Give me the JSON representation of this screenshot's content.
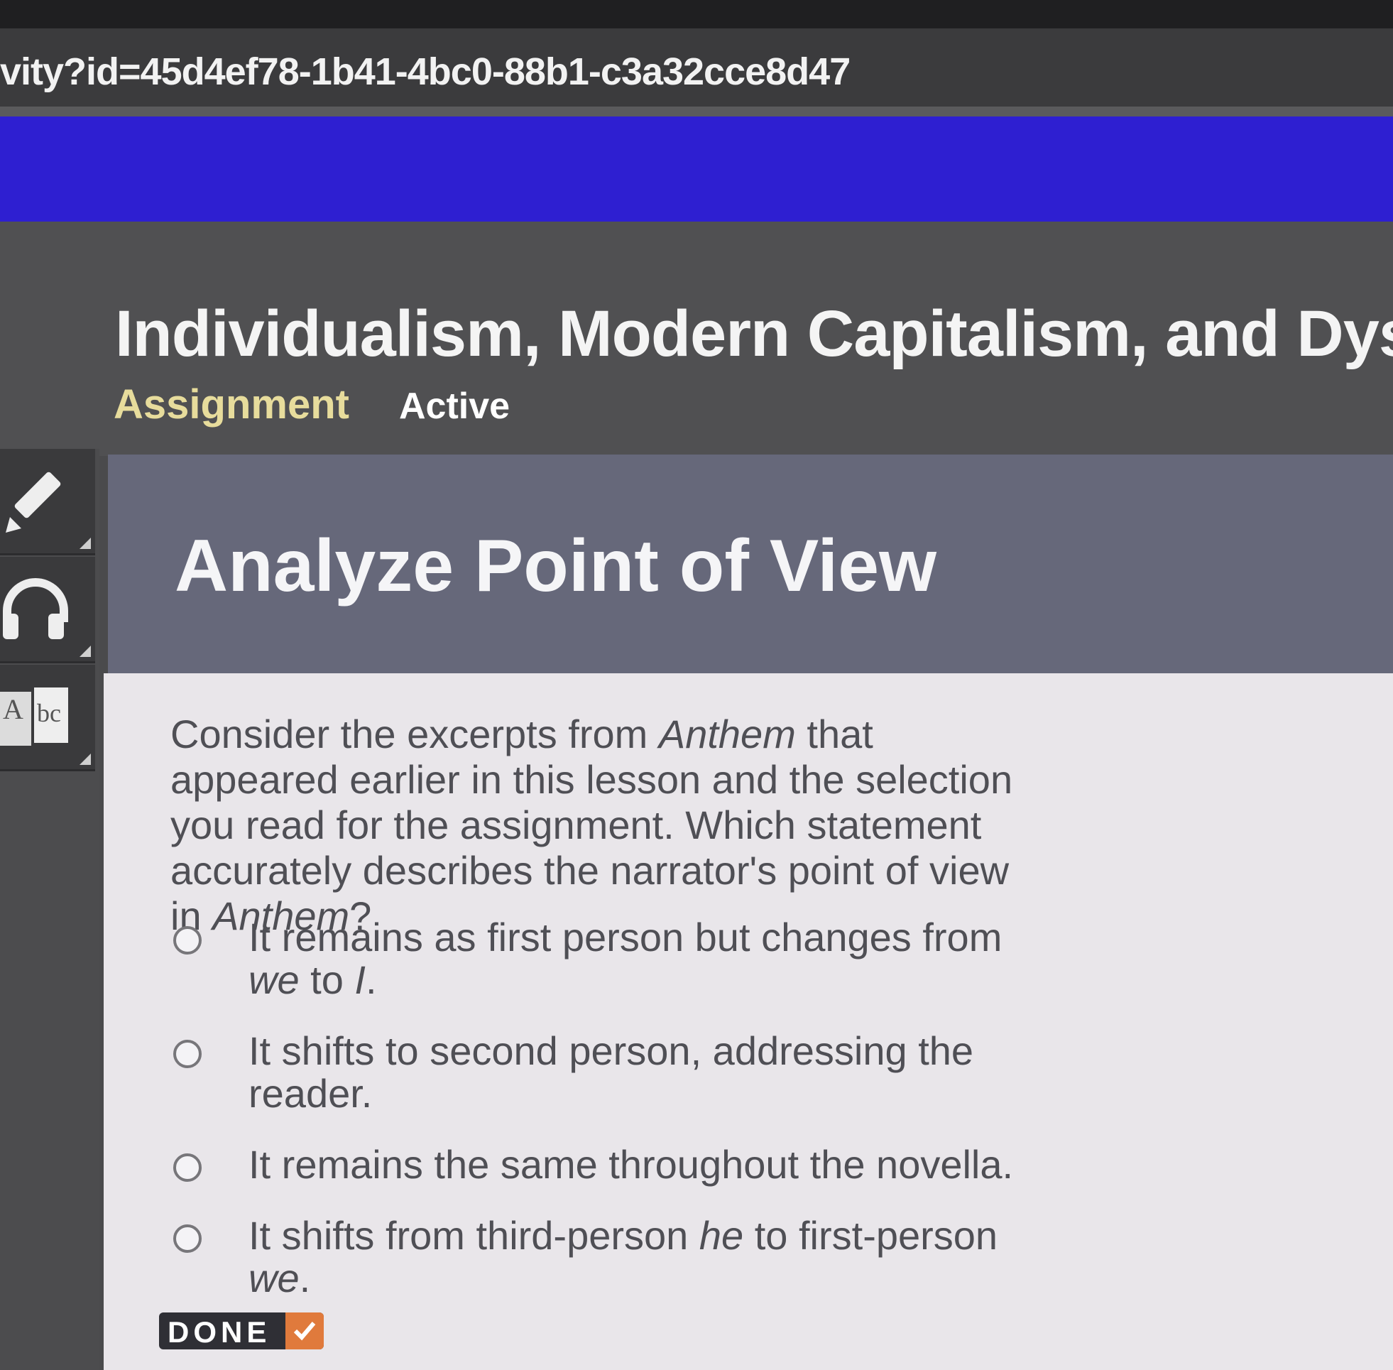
{
  "browser": {
    "url": "vity?id=45d4ef78-1b41-4bc0-88b1-c3a32cce8d47"
  },
  "header": {
    "course_title": "Individualism, Modern Capitalism, and Dystop",
    "assignment_label": "Assignment",
    "status": "Active"
  },
  "tools": [
    {
      "icon": "pencil-icon"
    },
    {
      "icon": "headphones-icon"
    },
    {
      "icon": "dictionary-icon",
      "glyph": "A|bc"
    }
  ],
  "activity": {
    "title": "Analyze Point of View",
    "question": {
      "part1": "Consider the excerpts from ",
      "title1": "Anthem",
      "part2": " that appeared earlier in this lesson and the selection you read for the assignment. Which statement accurately describes the narrator's point of view in ",
      "title2": "Anthem",
      "part3": "?"
    },
    "choices": [
      {
        "a": "It remains as first person but changes from ",
        "b": "we",
        "c": " to ",
        "d": "I",
        "e": "."
      },
      {
        "a": "It shifts to second person, addressing the reader."
      },
      {
        "a": "It remains the same throughout the novella."
      },
      {
        "a": "It shifts from third-person ",
        "b": "he",
        "c": " to first-person ",
        "d": "we",
        "e": "."
      }
    ],
    "done_label": "DONE"
  },
  "colors": {
    "brand_bar": "#2e1fd1",
    "assignment_label": "#e7dc9c",
    "done_check": "#e07a3c"
  }
}
